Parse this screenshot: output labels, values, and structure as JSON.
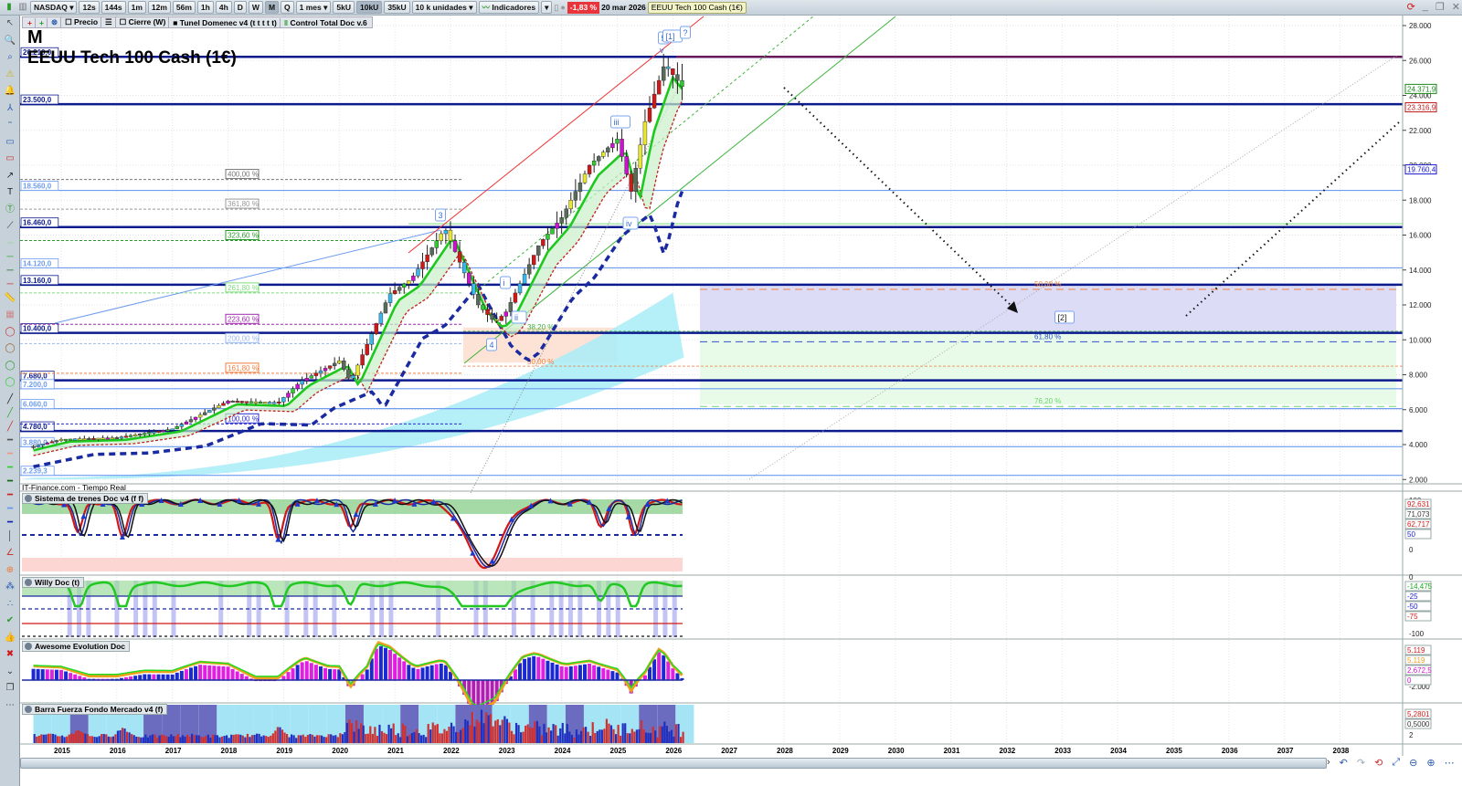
{
  "toolbar": {
    "symbol": "NASDAQ",
    "intervals": [
      "12s",
      "144s",
      "1m",
      "12m",
      "56m",
      "1h",
      "4h",
      "D",
      "W",
      "M",
      "Q"
    ],
    "active_interval": "M",
    "range": "1 mes",
    "units": [
      "5kU",
      "10kU",
      "35kU"
    ],
    "active_unit": "10kU",
    "unit_select": "10 k unidades",
    "indicators": "Indicadores",
    "change": "-1,83 %",
    "date": "20 mar 2026",
    "title": "EEUU Tech 100 Cash (1€)"
  },
  "legend": {
    "items": [
      "Precio",
      "Cierre (W)",
      "Tunel Domenec v4 (t t t t t)",
      "Control Total Doc v.6"
    ]
  },
  "main": {
    "period_letter": "M",
    "instrument": "EEUU Tech 100 Cash (1€)",
    "source": "IT-Finance.com - Tiempo Real"
  },
  "levels": [
    {
      "label": "26.210,0",
      "value": 26210,
      "color": "#0b1a8c",
      "thick": true
    },
    {
      "label": "23.500,0",
      "value": 23500,
      "color": "#0b1a8c",
      "thick": true
    },
    {
      "label": "18.560,0",
      "value": 18560,
      "color": "#6d9cf0",
      "thick": false
    },
    {
      "label": "16.460,0",
      "value": 16460,
      "color": "#0b1a8c",
      "thick": true
    },
    {
      "label": "14.120,0",
      "value": 14120,
      "color": "#6d9cf0",
      "thick": false
    },
    {
      "label": "13.160,0",
      "value": 13160,
      "color": "#0b1a8c",
      "thick": true
    },
    {
      "label": "10.400,0",
      "value": 10400,
      "color": "#0b1a8c",
      "thick": true
    },
    {
      "label": "7.680,0",
      "value": 7680,
      "color": "#0b1a8c",
      "thick": true
    },
    {
      "label": "7.200,0",
      "value": 7200,
      "color": "#6d9cf0",
      "thick": false
    },
    {
      "label": "6.060,0",
      "value": 6060,
      "color": "#6d9cf0",
      "thick": false
    },
    {
      "label": "4.780,0",
      "value": 4780,
      "color": "#0b1a8c",
      "thick": true
    },
    {
      "label": "3.880,0",
      "value": 3880,
      "color": "#6d9cf0",
      "thick": false
    },
    {
      "label": "2.239,3",
      "value": 2239.3,
      "color": "#6d9cf0",
      "thick": false
    }
  ],
  "fib_left": [
    {
      "label": "400,00 %",
      "value": 19500,
      "color": "#777"
    },
    {
      "label": "361,80 %",
      "value": 17800,
      "color": "#999"
    },
    {
      "label": "323,60 %",
      "value": 16000,
      "color": "#2a9a2a"
    },
    {
      "label": "261,80 %",
      "value": 13000,
      "color": "#7fdc7f"
    },
    {
      "label": "223,60 %",
      "value": 11200,
      "color": "#a02ab0"
    },
    {
      "label": "200,00 %",
      "value": 10100,
      "color": "#9ab8f0"
    },
    {
      "label": "161,80 %",
      "value": 8400,
      "color": "#f08040"
    },
    {
      "label": "100,00 %",
      "value": 5500,
      "color": "#2a2ad0"
    }
  ],
  "fib_mid": [
    {
      "label": "38,20 %",
      "value": 10700,
      "color": "#3cb43c"
    },
    {
      "label": "50,00 %",
      "value": 8700,
      "color": "#f08040"
    }
  ],
  "fib_right": [
    {
      "label": "50,00 %",
      "value": 13200,
      "color": "#f08040"
    },
    {
      "label": "61,80 %",
      "value": 10200,
      "color": "#3050d0"
    },
    {
      "label": "76,20 %",
      "value": 6500,
      "color": "#6fd66f"
    }
  ],
  "waves": [
    "3",
    "4",
    "i",
    "ii",
    "iii",
    "iv",
    "v",
    "5",
    "[1]",
    "?",
    "[2]"
  ],
  "right_axis": {
    "ticks": [
      "28.000",
      "26.000",
      "24.000",
      "22.000",
      "20.000",
      "18.000",
      "16.000",
      "14.000",
      "12.000",
      "10.000",
      "8.000",
      "6.000",
      "4.000",
      "2.000"
    ],
    "price_tags": [
      {
        "label": "24.371,9",
        "value": 24371.9,
        "color": "#1a8a1a"
      },
      {
        "label": "23.316,9",
        "value": 23316.9,
        "color": "#c01818"
      },
      {
        "label": "19.760,4",
        "value": 19760.4,
        "color": "#1a1ad0"
      }
    ]
  },
  "panels": [
    {
      "title": "Sistema de trenes Doc v4 (f f)",
      "ticks": [
        "100",
        "80",
        "40",
        "20",
        "0"
      ],
      "tags": [
        {
          "label": "92,631",
          "color": "#d01818"
        },
        {
          "label": "71,073",
          "color": "#333"
        },
        {
          "label": "62,717",
          "color": "#d01818"
        },
        {
          "label": "50",
          "color": "#1a1ad0"
        }
      ]
    },
    {
      "title": "Willy Doc (t)",
      "ticks": [
        "0",
        "-100"
      ],
      "tags": [
        {
          "label": "-14,475",
          "color": "#1aa81a"
        },
        {
          "label": "-25",
          "color": "#1a1ad0"
        },
        {
          "label": "-50",
          "color": "#1a1ad0"
        },
        {
          "label": "-75",
          "color": "#d01818"
        }
      ]
    },
    {
      "title": "Awesome Evolution Doc",
      "ticks": [
        "-2.000"
      ],
      "tags": [
        {
          "label": "5.119",
          "color": "#d01818"
        },
        {
          "label": "5.119",
          "color": "#f0a020"
        },
        {
          "label": "2.672,5",
          "color": "#d010d0"
        },
        {
          "label": "0",
          "color": "#d010d0"
        }
      ]
    },
    {
      "title": "Barra Fuerza Fondo Mercado v4 (f)",
      "ticks": [
        "6",
        "4",
        "2"
      ],
      "tags": [
        {
          "label": "5,2801",
          "color": "#d01818"
        },
        {
          "label": "0,5000",
          "color": "#333"
        }
      ]
    }
  ],
  "x_axis": [
    "2015",
    "2016",
    "2017",
    "2018",
    "2019",
    "2020",
    "2021",
    "2022",
    "2023",
    "2024",
    "2025",
    "2026",
    "2027",
    "2028",
    "2029",
    "2030",
    "2031",
    "2032",
    "2033",
    "2034",
    "2035",
    "2036",
    "2037",
    "2038"
  ],
  "chart_data": {
    "type": "candlestick",
    "title": "EEUU Tech 100 Cash (1€)",
    "timeframe": "monthly",
    "ylim": [
      2000,
      28000
    ],
    "path": [
      [
        2014.5,
        3900
      ],
      [
        2015,
        4300
      ],
      [
        2016,
        4400
      ],
      [
        2017,
        4900
      ],
      [
        2018,
        6500
      ],
      [
        2018.9,
        6400
      ],
      [
        2019.3,
        7600
      ],
      [
        2020,
        8800
      ],
      [
        2020.2,
        7600
      ],
      [
        2020.9,
        12600
      ],
      [
        2021.3,
        13500
      ],
      [
        2021.9,
        16400
      ],
      [
        2022.5,
        12000
      ],
      [
        2022.8,
        11000
      ],
      [
        2023,
        11600
      ],
      [
        2023.6,
        15500
      ],
      [
        2024,
        17000
      ],
      [
        2024.5,
        20000
      ],
      [
        2025,
        21500
      ],
      [
        2025.25,
        18500
      ],
      [
        2025.5,
        22500
      ],
      [
        2025.85,
        25800
      ],
      [
        2026.2,
        24371.9
      ]
    ]
  }
}
